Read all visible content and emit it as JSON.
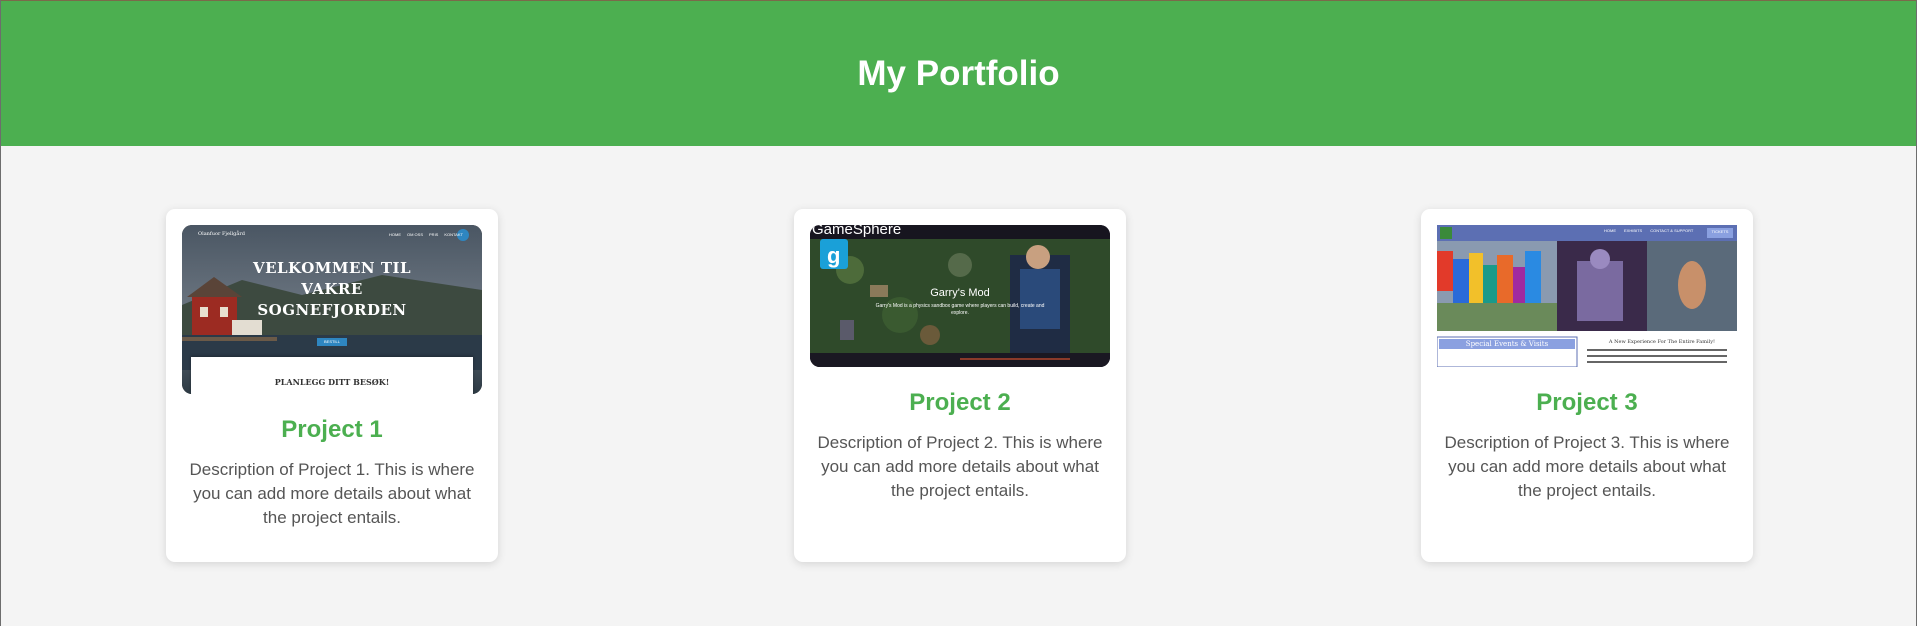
{
  "header": {
    "title": "My Portfolio"
  },
  "projects": [
    {
      "title": "Project 1",
      "description": "Description of Project 1. This is where you can add more details about what the project entails.",
      "thumb": {
        "brand": "Olanfuor Fjellgård",
        "nav": [
          "HOME",
          "OM OSS",
          "PRIS",
          "KONTAKT"
        ],
        "hero": [
          "VELKOMMEN TIL",
          "VAKRE",
          "SOGNEFJORDEN"
        ],
        "cta": "BESTILL",
        "panel": "PLANLEGG DITT BESØK!"
      }
    },
    {
      "title": "Project 2",
      "description": "Description of Project 2. This is where you can add more details about what the project entails.",
      "thumb": {
        "brand": "GameSphere",
        "game": "Garry's Mod",
        "blurb": "Garry's Mod is a physics sandbox game where players can build, create and explore."
      }
    },
    {
      "title": "Project 3",
      "description": "Description of Project 3. This is where you can add more details about what the project entails.",
      "thumb": {
        "nav": [
          "HOME",
          "EXHIBITS",
          "CONTACT & SUPPORT"
        ],
        "nav_button": "TICKETS",
        "events": "Special Events & Visits",
        "headline": "A New Experience For The Entire Family!"
      }
    }
  ],
  "colors": {
    "accent": "#4caf50",
    "background": "#f4f4f4",
    "text": "#555555"
  }
}
